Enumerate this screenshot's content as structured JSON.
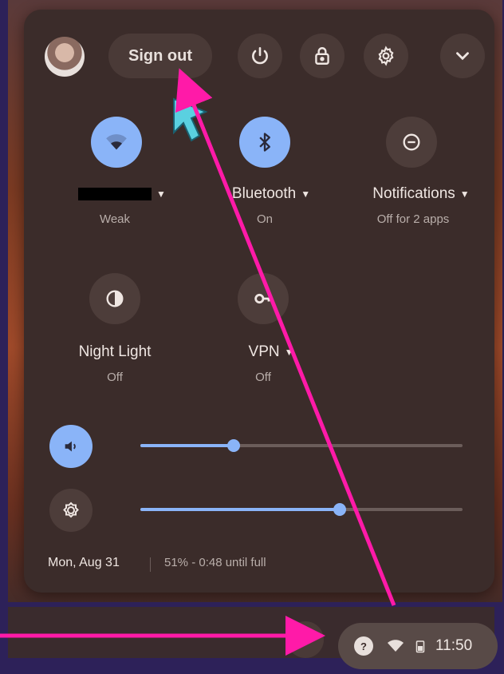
{
  "topbar": {
    "sign_out_label": "Sign out",
    "icons": [
      "power-icon",
      "lock-icon",
      "gear-icon",
      "chevron-down-icon"
    ]
  },
  "tiles": [
    {
      "name": "wifi",
      "label": "",
      "sub": "Weak",
      "state": "on",
      "has_dropdown": true
    },
    {
      "name": "bluetooth",
      "label": "Bluetooth",
      "sub": "On",
      "state": "on",
      "has_dropdown": true
    },
    {
      "name": "notifications",
      "label": "Notifications",
      "sub": "Off for 2 apps",
      "state": "off",
      "has_dropdown": true
    },
    {
      "name": "night-light",
      "label": "Night Light",
      "sub": "Off",
      "state": "off",
      "has_dropdown": false
    },
    {
      "name": "vpn",
      "label": "VPN",
      "sub": "Off",
      "state": "off",
      "has_dropdown": true
    }
  ],
  "sliders": {
    "volume": {
      "level": 0.29
    },
    "brightness": {
      "level": 0.62
    }
  },
  "footer": {
    "date": "Mon, Aug 31",
    "battery": "51% - 0:48 until full"
  },
  "tray": {
    "badge": "?",
    "time": "11:50"
  },
  "colors": {
    "accent": "#8ab4f8",
    "panel": "#3b2c2a",
    "annotation_arrow": "#ff1aa8"
  }
}
